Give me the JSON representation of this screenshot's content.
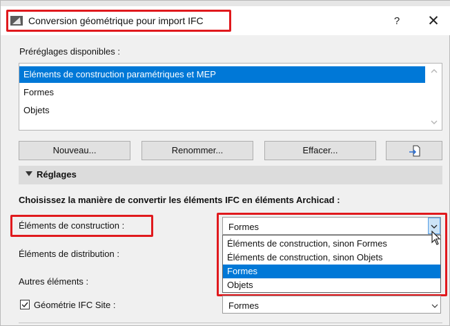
{
  "window": {
    "title": "Conversion géométrique pour import IFC",
    "help_glyph": "?",
    "close_glyph": "✕",
    "icon": "archicad-app-icon"
  },
  "presets": {
    "label": "Préréglages disponibles :",
    "items": [
      {
        "label": "Eléments de construction paramétriques et MEP",
        "selected": true
      },
      {
        "label": "Formes",
        "selected": false
      },
      {
        "label": "Objets",
        "selected": false
      }
    ]
  },
  "buttons": {
    "new": "Nouveau...",
    "rename": "Renommer...",
    "delete": "Effacer...",
    "import_icon": "import-icon"
  },
  "settings": {
    "header": "Réglages",
    "instruction": "Choisissez la manière de convertir les éléments IFC en éléments Archicad :",
    "rows": [
      {
        "label": "Éléments de construction :",
        "value": "Formes"
      },
      {
        "label": "Éléments de distribution :",
        "value": ""
      },
      {
        "label": "Autres éléments :",
        "value": ""
      },
      {
        "label": "Géométrie IFC Site :",
        "value": "Formes",
        "checked": true
      }
    ]
  },
  "dropdown": {
    "options": [
      {
        "label": "Éléments de construction, sinon Formes",
        "selected": false
      },
      {
        "label": "Éléments de construction, sinon Objets",
        "selected": false
      },
      {
        "label": "Formes",
        "selected": true
      },
      {
        "label": "Objets",
        "selected": false
      }
    ]
  },
  "colors": {
    "accent": "#0078d7",
    "highlight_frame": "#e0191d"
  }
}
